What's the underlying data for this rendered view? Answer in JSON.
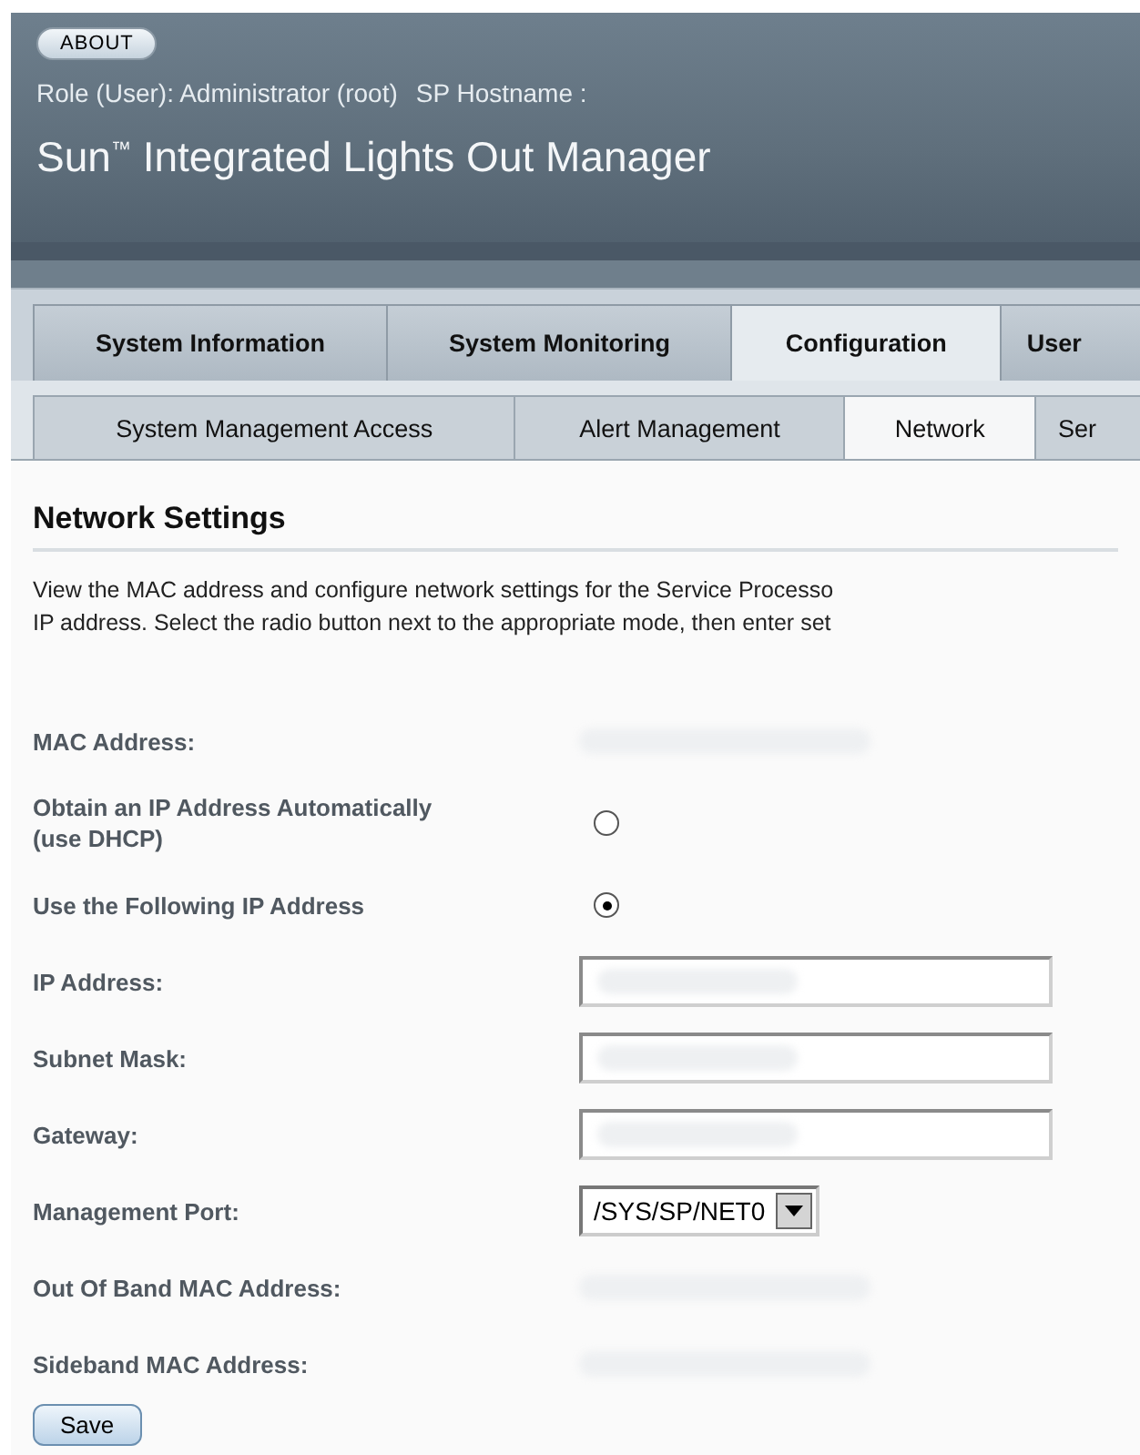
{
  "header": {
    "about_button": "ABOUT",
    "role": "Role (User): Administrator (root)",
    "hostname_label": "SP Hostname :",
    "title_brand": "Sun",
    "title_mark": "™",
    "title_rest": "Integrated Lights Out Manager"
  },
  "tabs": [
    {
      "label": "System Information",
      "selected": false
    },
    {
      "label": "System Monitoring",
      "selected": false
    },
    {
      "label": "Configuration",
      "selected": true
    },
    {
      "label": "User",
      "selected": false
    }
  ],
  "subtabs": [
    {
      "label": "System Management Access",
      "selected": false
    },
    {
      "label": "Alert Management",
      "selected": false
    },
    {
      "label": "Network",
      "selected": true
    },
    {
      "label": "Ser",
      "selected": false
    }
  ],
  "page": {
    "heading": "Network Settings",
    "description": [
      "View the MAC address and configure network settings for the Service Processo",
      "IP address. Select the radio button next to the appropriate mode, then enter set"
    ]
  },
  "fields": [
    {
      "kind": "readonly",
      "label": "MAC Address:",
      "blurred": true
    },
    {
      "kind": "radio",
      "label": "Obtain an IP Address Automatically (use DHCP)",
      "selected": false
    },
    {
      "kind": "radio",
      "label": "Use the Following IP Address",
      "selected": true
    },
    {
      "kind": "input",
      "label": "IP Address:",
      "blurred": true
    },
    {
      "kind": "input",
      "label": "Subnet Mask:",
      "blurred": true
    },
    {
      "kind": "input",
      "label": "Gateway:",
      "blurred": true
    },
    {
      "kind": "select",
      "label": "Management Port:",
      "value": "/SYS/SP/NET0"
    },
    {
      "kind": "readonly",
      "label": "Out Of Band MAC Address:",
      "blurred": true
    },
    {
      "kind": "readonly",
      "label": "Sideband MAC Address:",
      "blurred": true
    }
  ],
  "save_button": "Save"
}
